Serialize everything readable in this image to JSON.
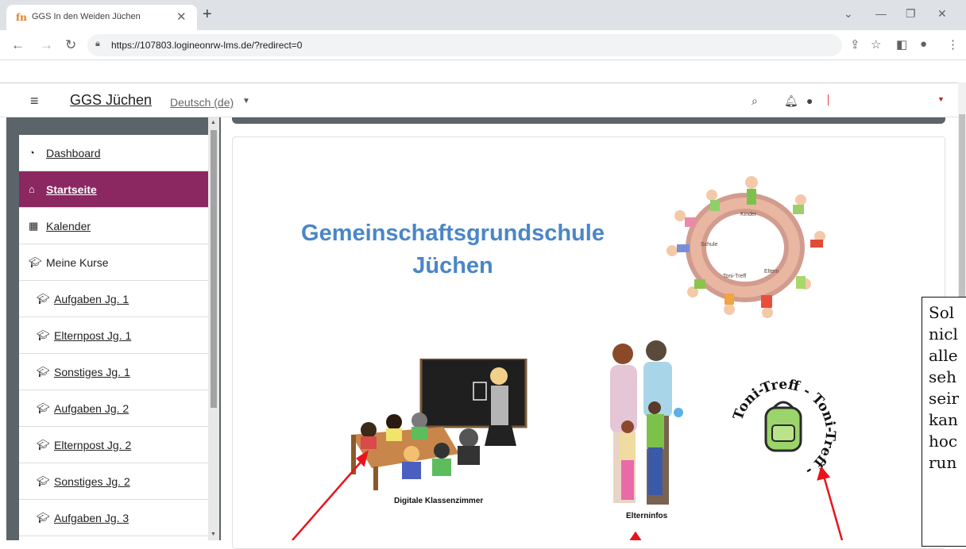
{
  "browser": {
    "tab_title": "GGS In den Weiden Jüchen",
    "tab_favicon": "fn",
    "new_tab": "+",
    "url": "https://107803.logineonrw-lms.de/?redirect=0"
  },
  "navbar": {
    "site_name": "GGS Jüchen",
    "language": "Deutsch (de)"
  },
  "sidebar": {
    "items": [
      {
        "label": "Dashboard",
        "icon": "dashboard-icon"
      },
      {
        "label": "Startseite",
        "icon": "home-icon",
        "active": true
      },
      {
        "label": "Kalender",
        "icon": "calendar-icon"
      },
      {
        "label": "Meine Kurse",
        "icon": "graduation-cap-icon"
      },
      {
        "label": "Aufgaben Jg. 1",
        "icon": "graduation-cap-icon"
      },
      {
        "label": "Elternpost Jg. 1",
        "icon": "graduation-cap-icon"
      },
      {
        "label": "Sonstiges Jg. 1",
        "icon": "graduation-cap-icon"
      },
      {
        "label": "Aufgaben Jg. 2",
        "icon": "graduation-cap-icon"
      },
      {
        "label": "Elternpost Jg. 2",
        "icon": "graduation-cap-icon"
      },
      {
        "label": "Sonstiges Jg. 2",
        "icon": "graduation-cap-icon"
      },
      {
        "label": "Aufgaben Jg. 3",
        "icon": "graduation-cap-icon"
      }
    ]
  },
  "main": {
    "title_line1": "Gemeinschaftsgrundschule",
    "title_line2": "Jüchen",
    "logo_words": [
      "Kinder",
      "Schule",
      "Toni-Treff",
      "Eltern"
    ],
    "tiles": [
      {
        "caption": "Digitale Klassenzimmer"
      },
      {
        "caption": "Elterninfos"
      },
      {
        "caption": ""
      }
    ],
    "toni_treff_ring": "Toni-Treff - Toni-Treff -"
  },
  "annotation": {
    "lines": [
      "Sol",
      "nicl",
      "alle",
      "seh",
      "seir",
      "kan",
      "hoc",
      "run"
    ]
  },
  "colors": {
    "accent": "#8b2761",
    "title_blue": "#4a86c8",
    "sidebar_bg": "#5b6468",
    "arrow_red": "#e8141b"
  }
}
